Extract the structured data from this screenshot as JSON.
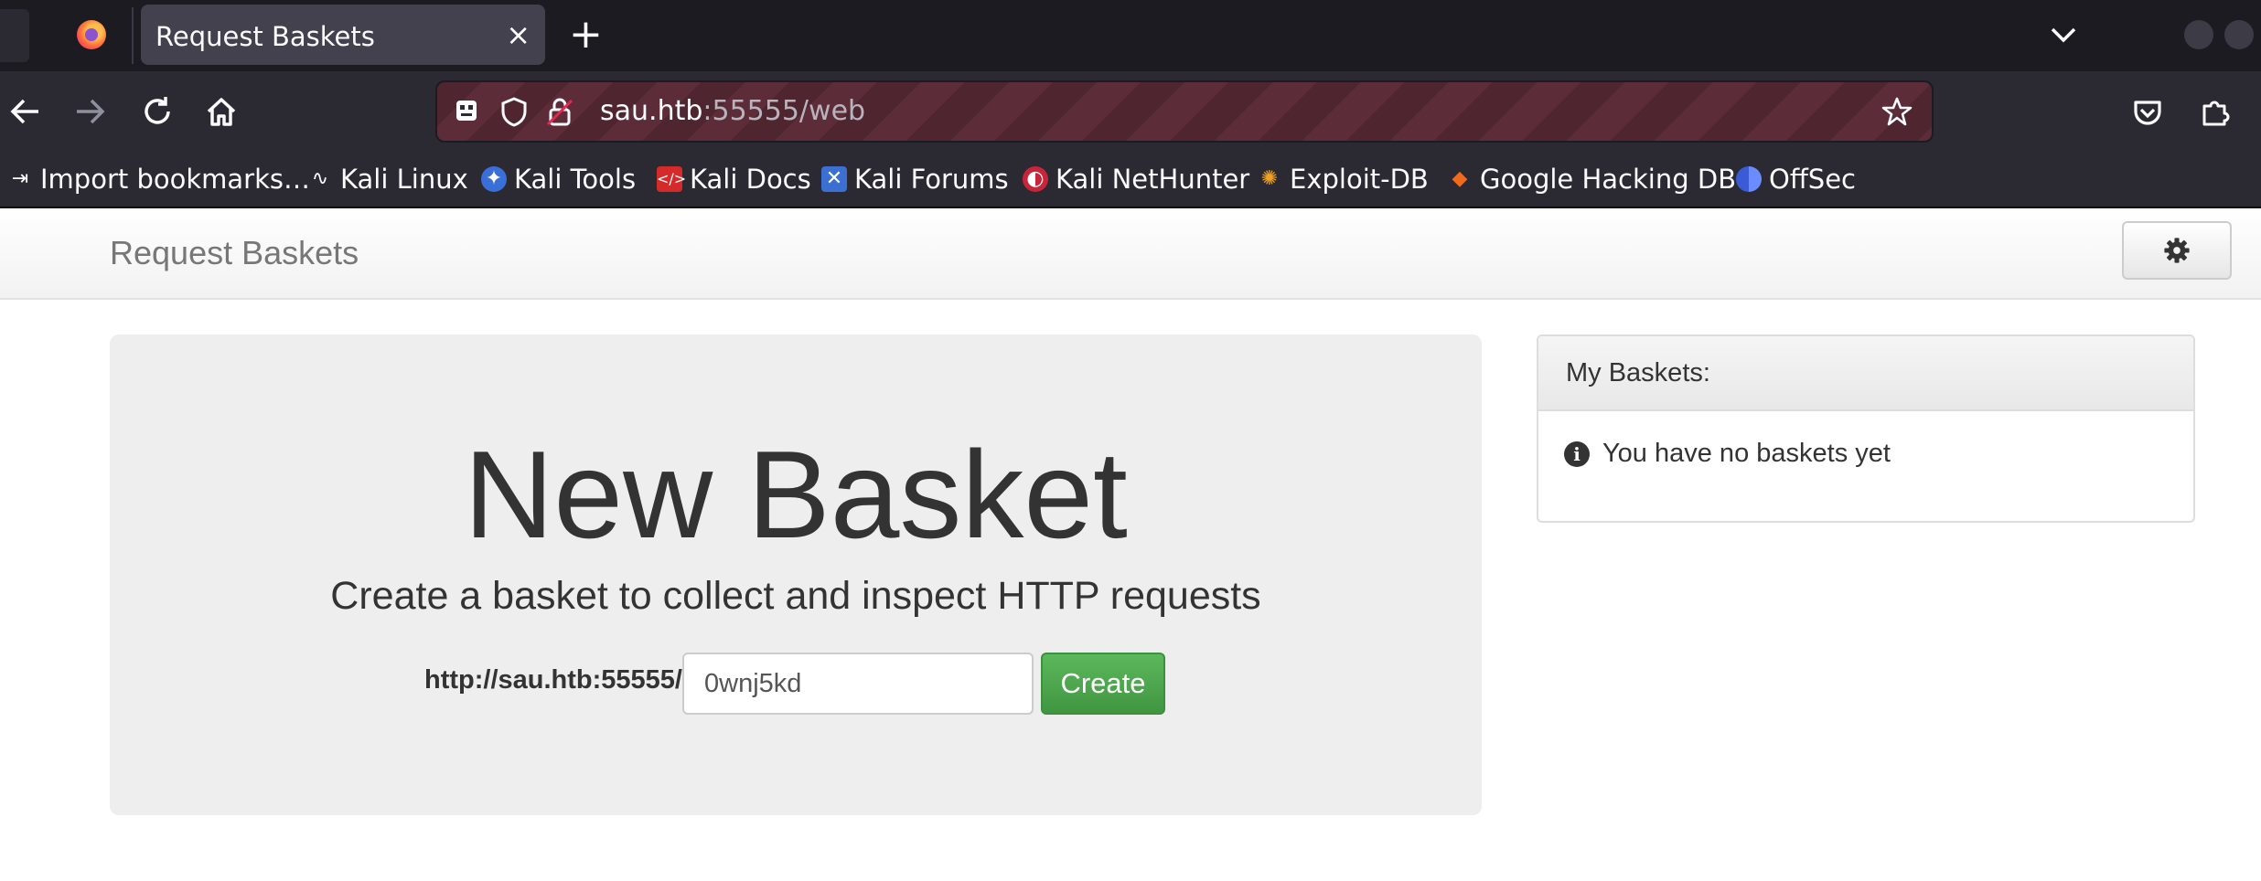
{
  "browser": {
    "tab_title": "Request Baskets",
    "tab_close_glyph": "×",
    "new_tab_glyph": "+",
    "url_host": "sau.htb",
    "url_rest": ":55555/web",
    "bookmarks": [
      {
        "label": "Import bookmarks…",
        "icon": "import-icon"
      },
      {
        "label": "Kali Linux",
        "icon": "kali-dragon-icon"
      },
      {
        "label": "Kali Tools",
        "icon": "kali-tools-icon"
      },
      {
        "label": "Kali Docs",
        "icon": "kali-docs-icon"
      },
      {
        "label": "Kali Forums",
        "icon": "kali-forums-icon"
      },
      {
        "label": "Kali NetHunter",
        "icon": "kali-nethunter-icon"
      },
      {
        "label": "Exploit-DB",
        "icon": "exploit-db-icon"
      },
      {
        "label": "Google Hacking DB",
        "icon": "ghdb-icon"
      },
      {
        "label": "OffSec",
        "icon": "offsec-icon"
      }
    ]
  },
  "page": {
    "brand": "Request Baskets",
    "settings_icon": "gear-icon",
    "jumbotron": {
      "title": "New Basket",
      "lead": "Create a basket to collect and inspect HTTP requests",
      "url_prefix": "http://sau.htb:55555/",
      "basket_name_value": "0wnj5kd",
      "create_label": "Create"
    },
    "my_baskets": {
      "heading": "My Baskets:",
      "empty_message": "You have no baskets yet"
    }
  },
  "colors": {
    "create_button": "#5cb85c",
    "jumbotron_bg": "#eeeeee",
    "urlbar_stripe": "#4f2530",
    "browser_chrome": "#2b2a33"
  }
}
